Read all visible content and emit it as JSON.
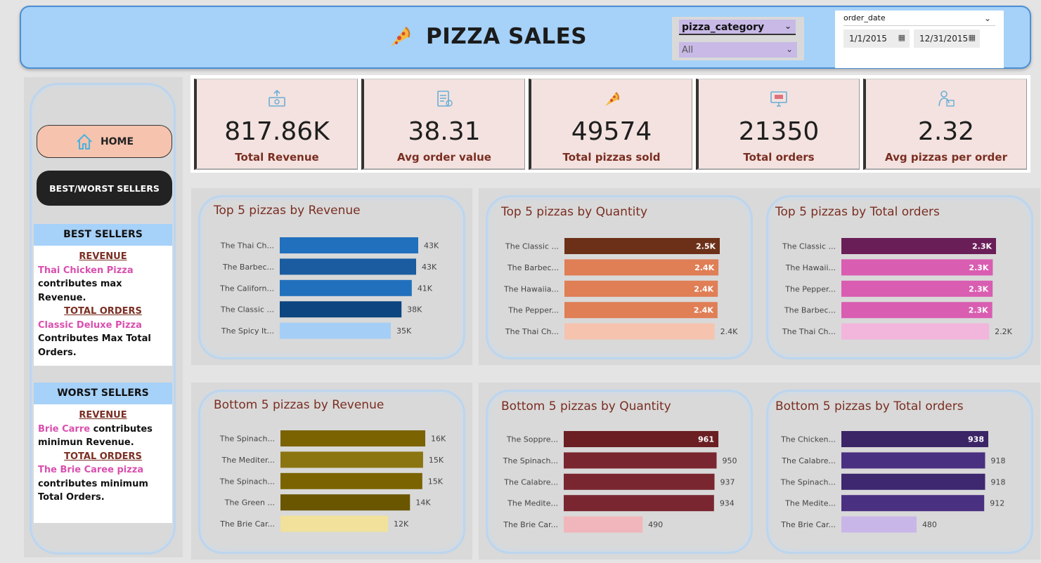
{
  "header": {
    "title": "PIZZA SALES",
    "category_slicer": {
      "label": "pizza_category",
      "value": "All"
    },
    "date_slicer": {
      "label": "order_date",
      "start": "1/1/2015",
      "end": "12/31/2015"
    }
  },
  "sidebar": {
    "home_label": "HOME",
    "best_worst_label": "BEST/WORST SELLERS",
    "best": {
      "title": "BEST SELLERS",
      "rev_head": "REVENUE",
      "rev_name": "Thai Chicken Pizza",
      "rev_text": "contributes max Revenue.",
      "ord_head": "TOTAL ORDERS",
      "ord_name": "Classic Deluxe Pizza",
      "ord_text": "Contributes Max Total Orders."
    },
    "worst": {
      "title": "WORST SELLERS",
      "rev_head": "REVENUE",
      "rev_name": "Brie Carre",
      "rev_text": " contributes minimun Revenue.",
      "ord_head": "TOTAL ORDERS",
      "ord_name": "The Brie Caree pizza",
      "ord_text": "contributes minimum Total Orders."
    }
  },
  "kpis": [
    {
      "value": "817.86K",
      "label": "Total Revenue",
      "icon": "money-icon"
    },
    {
      "value": "38.31",
      "label": "Avg order value",
      "icon": "receipt-icon"
    },
    {
      "value": "49574",
      "label": "Total pizzas sold",
      "icon": "pizza-icon"
    },
    {
      "value": "21350",
      "label": "Total orders",
      "icon": "monitor-icon"
    },
    {
      "value": "2.32",
      "label": "Avg pizzas per order",
      "icon": "delivery-icon"
    }
  ],
  "chart_data": [
    {
      "type": "bar",
      "title": "Top 5 pizzas by Revenue",
      "categories": [
        "The Thai Ch...",
        "The Barbec...",
        "The Californ...",
        "The Classic ...",
        "The Spicy It..."
      ],
      "values": [
        43434,
        42768,
        41410,
        38180,
        34831
      ],
      "value_labels": [
        "43K",
        "43K",
        "41K",
        "38K",
        "35K"
      ],
      "colors": [
        "#2170bd",
        "#1a5c9f",
        "#2170bd",
        "#0d4580",
        "#a5cef6"
      ],
      "max": 43434,
      "label_inside": [
        false,
        false,
        false,
        false,
        false
      ]
    },
    {
      "type": "bar",
      "title": "Top 5 pizzas by Quantity",
      "categories": [
        "The Classic ...",
        "The Barbec...",
        "The Hawaiia...",
        "The Pepper...",
        "The Thai Ch..."
      ],
      "values": [
        2453,
        2432,
        2422,
        2418,
        2371
      ],
      "value_labels": [
        "2.5K",
        "2.4K",
        "2.4K",
        "2.4K",
        "2.4K"
      ],
      "colors": [
        "#6c3018",
        "#e07e56",
        "#e07e56",
        "#e07e56",
        "#f5c3ae"
      ],
      "max": 2453,
      "label_inside": [
        true,
        true,
        true,
        true,
        false
      ]
    },
    {
      "type": "bar",
      "title": "Top 5 pizzas by Total orders",
      "categories": [
        "The Classic ...",
        "The Hawaii...",
        "The Pepper...",
        "The Barbec...",
        "The Thai Ch..."
      ],
      "values": [
        2329,
        2280,
        2278,
        2273,
        2225
      ],
      "value_labels": [
        "2.3K",
        "2.3K",
        "2.3K",
        "2.3K",
        "2.2K"
      ],
      "colors": [
        "#6a1e58",
        "#d95db1",
        "#d95db1",
        "#d95db1",
        "#f2b5dc"
      ],
      "max": 2329,
      "label_inside": [
        true,
        true,
        true,
        true,
        false
      ]
    },
    {
      "type": "bar",
      "title": "Bottom 5 pizzas by Revenue",
      "categories": [
        "The Spinach...",
        "The Mediter...",
        "The Spinach...",
        "The Green ...",
        "The Brie Car..."
      ],
      "values": [
        15596,
        15360,
        15278,
        13956,
        11588
      ],
      "value_labels": [
        "16K",
        "15K",
        "15K",
        "14K",
        "12K"
      ],
      "colors": [
        "#7a6300",
        "#8a7510",
        "#7a6300",
        "#6a5600",
        "#f1e19a"
      ],
      "max": 15596,
      "label_inside": [
        false,
        false,
        false,
        false,
        false
      ]
    },
    {
      "type": "bar",
      "title": "Bottom 5 pizzas by Quantity",
      "categories": [
        "The Soppre...",
        "The Spinach...",
        "The Calabre...",
        "The Medite...",
        "The Brie Car..."
      ],
      "values": [
        961,
        950,
        937,
        934,
        490
      ],
      "value_labels": [
        "961",
        "950",
        "937",
        "934",
        "490"
      ],
      "colors": [
        "#6b1f22",
        "#7a2630",
        "#7a2630",
        "#7a2630",
        "#f0b6bb"
      ],
      "max": 961,
      "label_inside": [
        true,
        false,
        false,
        false,
        false
      ]
    },
    {
      "type": "bar",
      "title": "Bottom 5 pizzas by Total orders",
      "categories": [
        "The Chicken...",
        "The Calabre...",
        "The Spinach...",
        "The Medite...",
        "The Brie Car..."
      ],
      "values": [
        938,
        918,
        918,
        912,
        480
      ],
      "value_labels": [
        "938",
        "918",
        "918",
        "912",
        "480"
      ],
      "colors": [
        "#3b2566",
        "#4a3080",
        "#3e2870",
        "#4a3080",
        "#c9b6e8"
      ],
      "max": 938,
      "label_inside": [
        true,
        false,
        false,
        false,
        false
      ]
    }
  ]
}
